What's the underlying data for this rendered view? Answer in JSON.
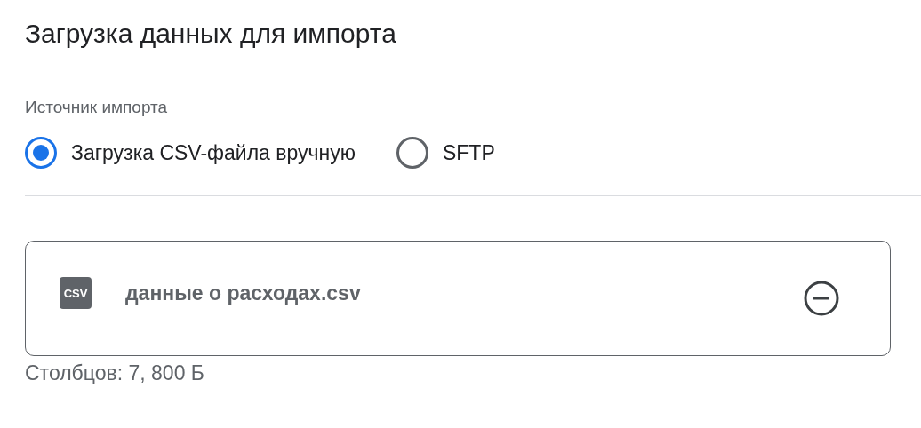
{
  "title": "Загрузка данных для импорта",
  "source": {
    "label": "Источник импорта",
    "options": [
      {
        "label": "Загрузка CSV-файла вручную",
        "selected": true
      },
      {
        "label": "SFTP",
        "selected": false
      }
    ]
  },
  "file": {
    "type_label": "CSV",
    "name": "данные о расходах.csv",
    "details": "Столбцов: 7, 800 Б"
  }
}
